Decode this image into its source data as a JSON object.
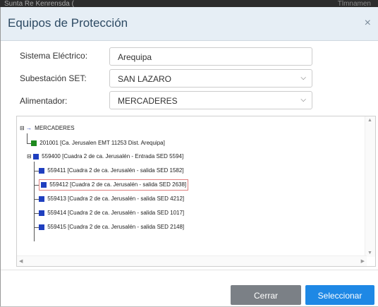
{
  "background": {
    "left_text": "Sunta Re Kenrensda (",
    "right_text": "Tlmnamen"
  },
  "modal": {
    "title": "Equipos de Protección",
    "close_glyph": "×"
  },
  "form": {
    "sistema_label": "Sistema Eléctrico:",
    "sistema_value": "Arequipa",
    "subestacion_label": "Subestación SET:",
    "subestacion_value": "SAN LAZARO",
    "alimentador_label": "Alimentador:",
    "alimentador_value": "MERCADERES"
  },
  "tree": {
    "root": {
      "label": "MERCADERES",
      "toggle": "⊟"
    },
    "items": [
      {
        "label": "201001 [Ca. Jerusalen EMT 11253 Dist. Arequipa]",
        "color": "#1e8a1e"
      },
      {
        "label": "559400 [Cuadra 2 de ca. Jerusalén - Entrada SED 5594]",
        "color": "#1f3fbf",
        "toggle": "⊟"
      },
      {
        "label": "559411 [Cuadra 2 de ca. Jerusalén - salida SED 1582]",
        "color": "#1f3fbf"
      },
      {
        "label": "559412 [Cuadra 2 de ca. Jerusalén - salida SED 2638]",
        "color": "#1f3fbf",
        "selected": true
      },
      {
        "label": "559413 [Cuadra 2 de ca. Jerusalén - salida SED 4212]",
        "color": "#1f3fbf"
      },
      {
        "label": "559414 [Cuadra 2 de ca. Jerusalén - salida SED 1017]",
        "color": "#1f3fbf"
      },
      {
        "label": "559415 [Cuadra 2 de ca. Jerusalén - salida SED 2148]",
        "color": "#1f3fbf"
      }
    ]
  },
  "footer": {
    "cerrar_label": "Cerrar",
    "seleccionar_label": "Seleccionar"
  },
  "colors": {
    "primary": "#1e88e5",
    "secondary": "#7b8086",
    "header_bg": "#e6eef5",
    "highlight": "#e08080"
  }
}
